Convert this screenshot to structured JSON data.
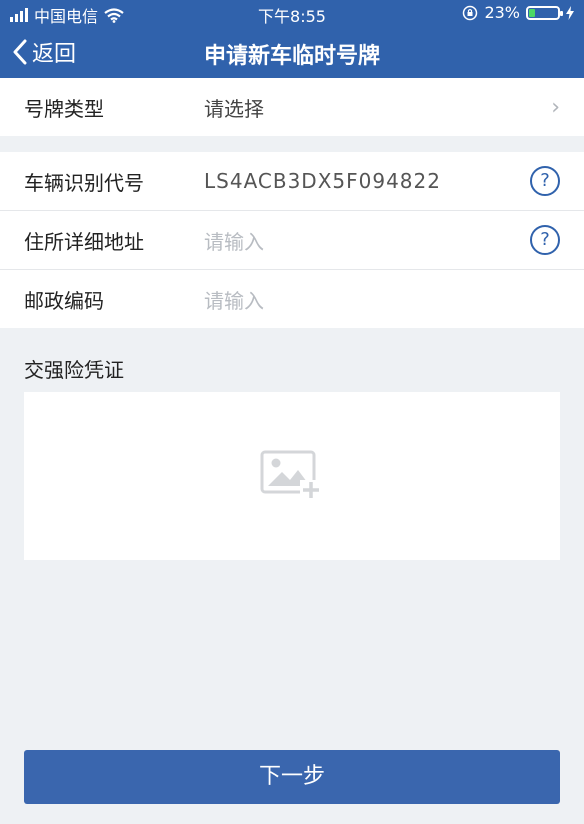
{
  "status_bar": {
    "carrier": "中国电信",
    "time": "下午8:55",
    "battery": "23%",
    "battery_level": 0.23
  },
  "nav": {
    "back_label": "返回",
    "title": "申请新车临时号牌"
  },
  "plate_type": {
    "label": "号牌类型",
    "value": "请选择"
  },
  "vehicle_form": {
    "vin_label": "车辆识别代号",
    "vin_value": "LS4ACB3DX5F094822",
    "address_label": "住所详细地址",
    "address_placeholder": "请输入",
    "postcode_label": "邮政编码",
    "postcode_placeholder": "请输入",
    "help_symbol": "?"
  },
  "insurance": {
    "title": "交强险凭证"
  },
  "footer": {
    "next_label": "下一步"
  },
  "colors": {
    "primary": "#3062ac",
    "background": "#eef1f4"
  }
}
